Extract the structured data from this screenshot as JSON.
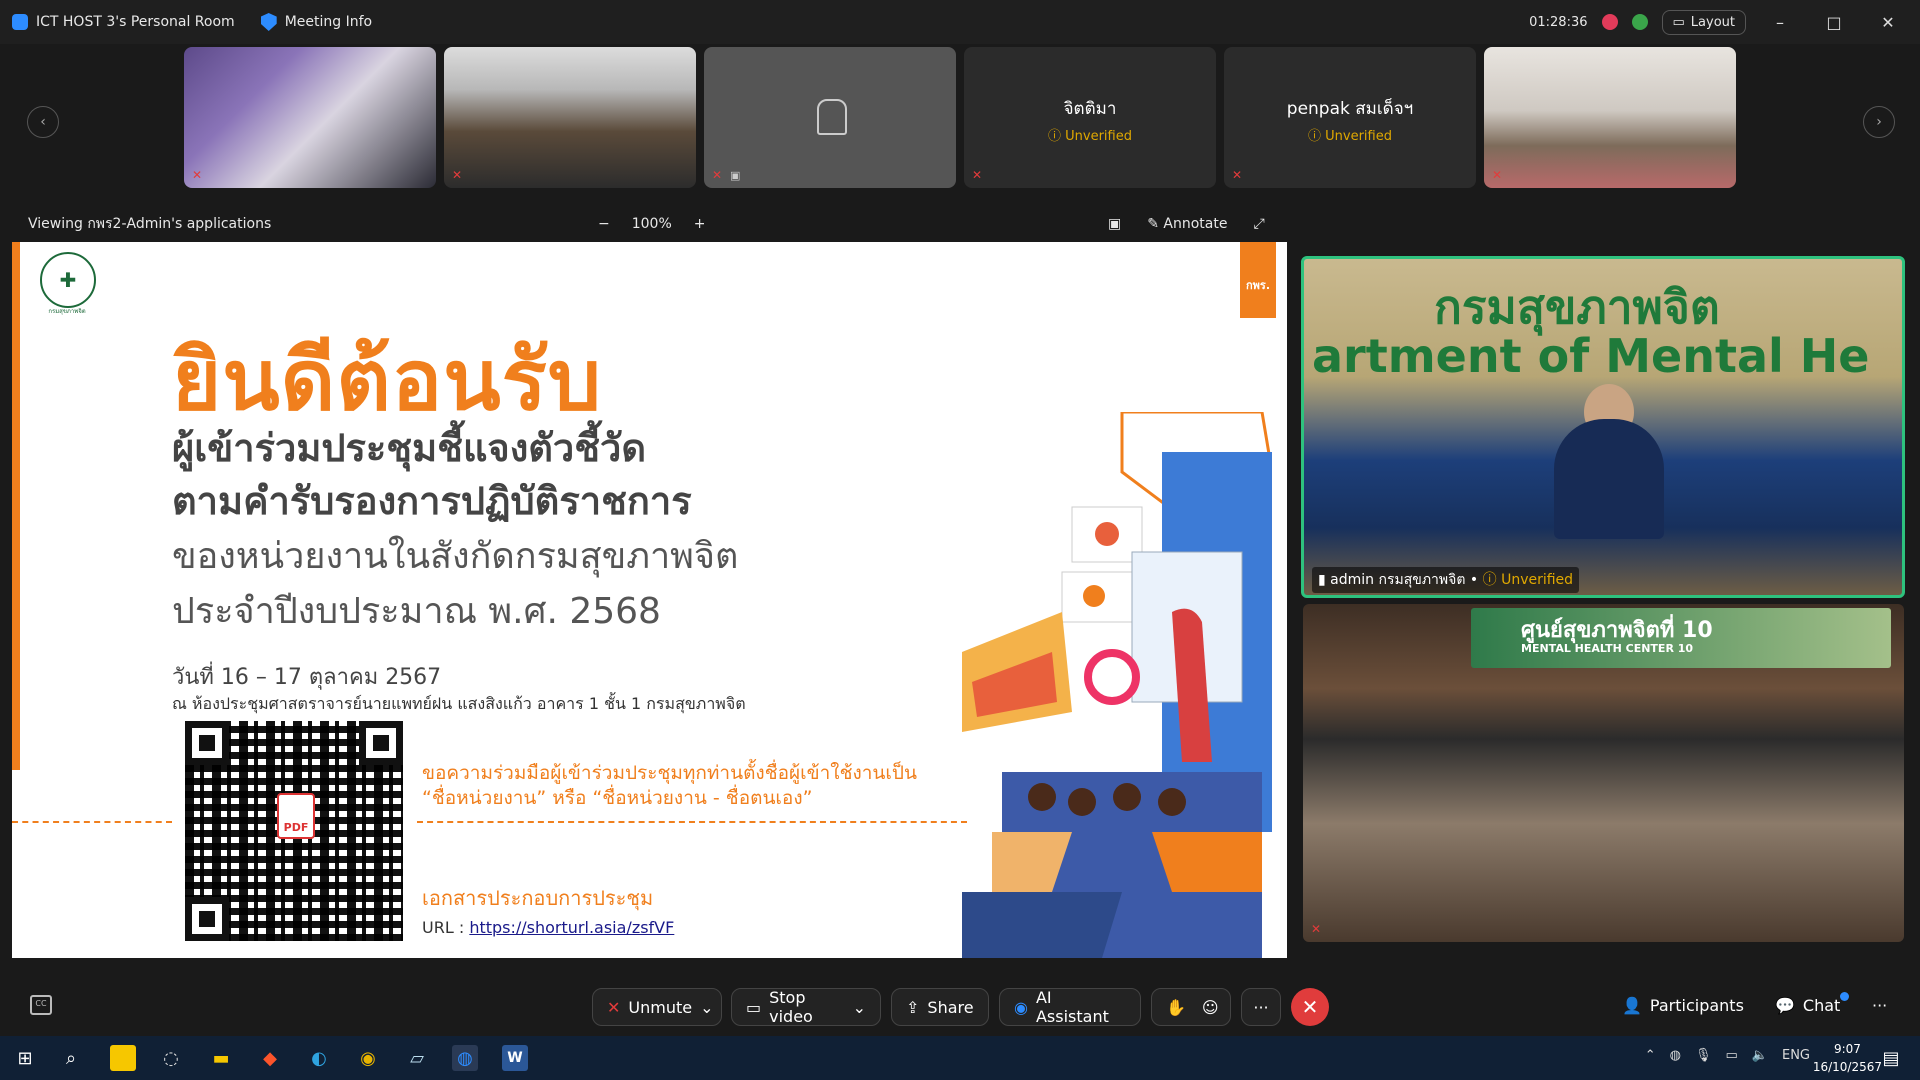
{
  "titlebar": {
    "room_title": "ICT HOST 3's Personal Room",
    "meeting_info": "Meeting Info",
    "timer": "01:28:36",
    "layout_label": "Layout",
    "minimize": "–",
    "maximize": "□",
    "close": "✕"
  },
  "strip": {
    "prev": "‹",
    "next": "›",
    "tiles": [
      {
        "name": "",
        "status": ""
      },
      {
        "name": "",
        "status": ""
      },
      {
        "name": "",
        "status": ""
      },
      {
        "name": "จิตติมา",
        "status": "Unverified"
      },
      {
        "name": "penpak สมเด็จฯ",
        "status": "Unverified"
      },
      {
        "name": "",
        "status": ""
      }
    ]
  },
  "sharebar": {
    "viewing": "Viewing กพร2-Admin's applications",
    "zoom_out": "−",
    "zoom_level": "100%",
    "zoom_in": "+",
    "annotate": "Annotate"
  },
  "slide": {
    "logo_caption": "กรมสุขภาพจิต",
    "badge": "กพร.",
    "welcome": "ยินดีต้อนรับ",
    "line1": "ผู้เข้าร่วมประชุมชี้แจงตัวชี้วัด",
    "line2": "ตามคำรับรองการปฏิบัติราชการ",
    "line3": "ของหน่วยงานในสังกัดกรมสุขภาพจิต",
    "line4": "ประจำปีงบประมาณ พ.ศ. 2568",
    "date": "วันที่ 16 – 17 ตุลาคม 2567",
    "venue": "ณ ห้องประชุมศาสตราจารย์นายแพทย์ฝน แสงสิงแก้ว อาคาร 1 ชั้น 1 กรมสุขภาพจิต",
    "pdf": "PDF",
    "request1": "ขอความร่วมมือผู้เข้าร่วมประชุมทุกท่านตั้งชื่อผู้เข้าใช้งานเป็น",
    "request2": "“ชื่อหน่วยงาน” หรือ “ชื่อหน่วยงาน - ชื่อตนเอง”",
    "docs": "เอกสารประกอบการประชุม",
    "url_label": "URL : ",
    "url": "https://shorturl.asia/zsfVF"
  },
  "videos": {
    "main_sign1": "กรมสุขภาพจิต",
    "main_sign2": "artment of Mental He",
    "main_name": "admin กรมสุขภาพจิต",
    "main_status": "Unverified",
    "second_banner": "ศูนย์สุขภาพจิตที่ 10",
    "second_banner_en": "MENTAL HEALTH CENTER 10"
  },
  "toolbar": {
    "cc": "CC",
    "unmute": "Unmute",
    "stop_video": "Stop video",
    "share": "Share",
    "ai_assistant": "AI Assistant",
    "more": "···",
    "end": "✕",
    "participants": "Participants",
    "chat": "Chat",
    "more_right": "···"
  },
  "taskbar": {
    "lang": "ENG",
    "time": "9:07",
    "date": "16/10/2567"
  },
  "colors": {
    "accent_orange": "#f07f1d",
    "zoom_blue": "#2d8cff",
    "end_red": "#e03c3c",
    "active_speaker_green": "#2ec27e",
    "unverified_amber": "#e0a800"
  }
}
